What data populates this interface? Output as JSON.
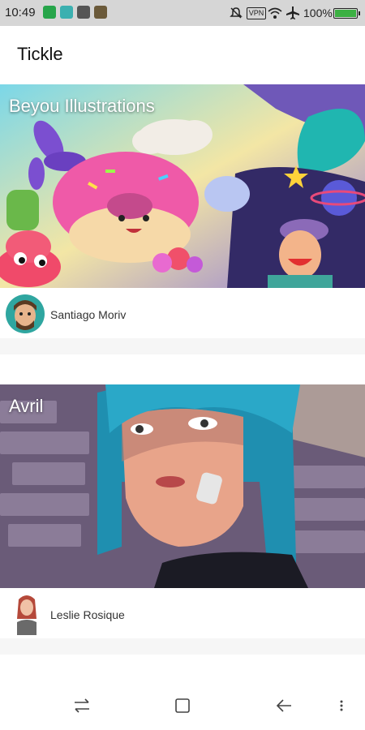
{
  "status_bar": {
    "time": "10:49",
    "vpn_label": "VPN",
    "battery": "100%",
    "icons": [
      "shield-icon",
      "usb-icon",
      "app-icon",
      "eye-icon",
      "mute-icon",
      "wifi-icon",
      "airplane-icon",
      "battery-icon"
    ]
  },
  "app": {
    "title": "Tickle"
  },
  "feed": [
    {
      "title": "Beyou Illustrations",
      "author": "Santiago Moriv"
    },
    {
      "title": "Avril",
      "author": "Leslie Rosique"
    }
  ],
  "nav": {
    "icons": [
      "switch-icon",
      "home-icon",
      "back-icon",
      "menu-icon"
    ]
  },
  "colors": {
    "status_bar_bg": "#d6d6d6",
    "accent_green": "#3cb043"
  }
}
